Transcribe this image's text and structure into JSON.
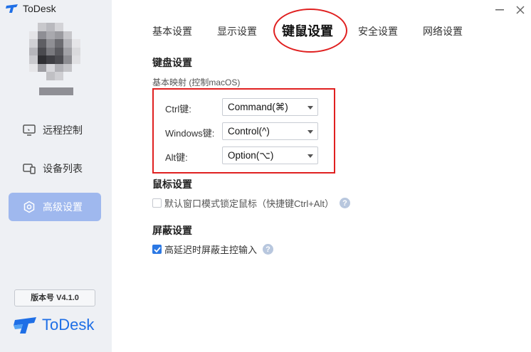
{
  "app": {
    "title": "ToDesk"
  },
  "window": {
    "minimize_icon": "minus",
    "close_icon": "×"
  },
  "sidebar": {
    "items": [
      {
        "label": "远程控制",
        "icon": "monitor-icon"
      },
      {
        "label": "设备列表",
        "icon": "devices-icon"
      },
      {
        "label": "高级设置",
        "icon": "hexagon-settings-icon",
        "active": true
      }
    ],
    "version": "版本号 V4.1.0",
    "brand": "ToDesk"
  },
  "tabs": [
    {
      "label": "基本设置"
    },
    {
      "label": "显示设置"
    },
    {
      "label": "键鼠设置",
      "active": true
    },
    {
      "label": "安全设置"
    },
    {
      "label": "网络设置"
    }
  ],
  "keyboard": {
    "title": "键盘设置",
    "subtitle": "基本映射 (控制macOS)",
    "mappings": [
      {
        "label": "Ctrl键:",
        "value": "Command(⌘)"
      },
      {
        "label": "Windows键:",
        "value": "Control(^)"
      },
      {
        "label": "Alt键:",
        "value": "Option(⌥)"
      }
    ]
  },
  "mouse": {
    "title": "鼠标设置",
    "lock_label": "默认窗口模式锁定鼠标（快捷键Ctrl+Alt）",
    "lock_checked": false
  },
  "shield": {
    "title": "屏蔽设置",
    "block_label": "高延迟时屏蔽主控输入",
    "block_checked": true
  },
  "help_glyph": "?",
  "colors": {
    "accent": "#2b78e4",
    "active_nav": "#9fb8ee",
    "annotation": "#e02020",
    "sidebar_bg": "#eef0f4"
  }
}
